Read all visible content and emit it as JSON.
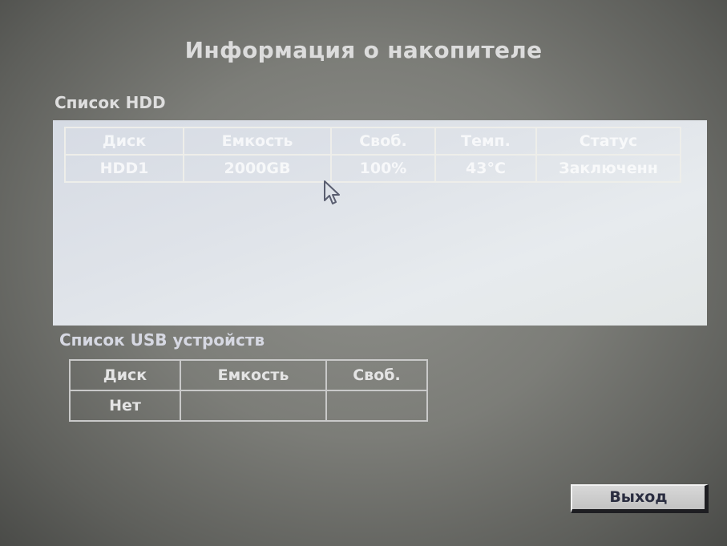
{
  "title": "Информация о накопителе",
  "hdd": {
    "label": "Список HDD",
    "headers": [
      "Диск",
      "Емкость",
      "Своб.",
      "Темп.",
      "Статус"
    ],
    "rows": [
      [
        "HDD1",
        "2000GB",
        "100%",
        "43°C",
        "Заключенн"
      ]
    ]
  },
  "usb": {
    "label": "Список USB устройств",
    "headers": [
      "Диск",
      "Емкость",
      "Своб."
    ],
    "rows": [
      [
        "Нет",
        "",
        ""
      ]
    ]
  },
  "buttons": {
    "exit": "Выход"
  },
  "icons": {
    "cursor": "mouse-pointer-icon"
  }
}
